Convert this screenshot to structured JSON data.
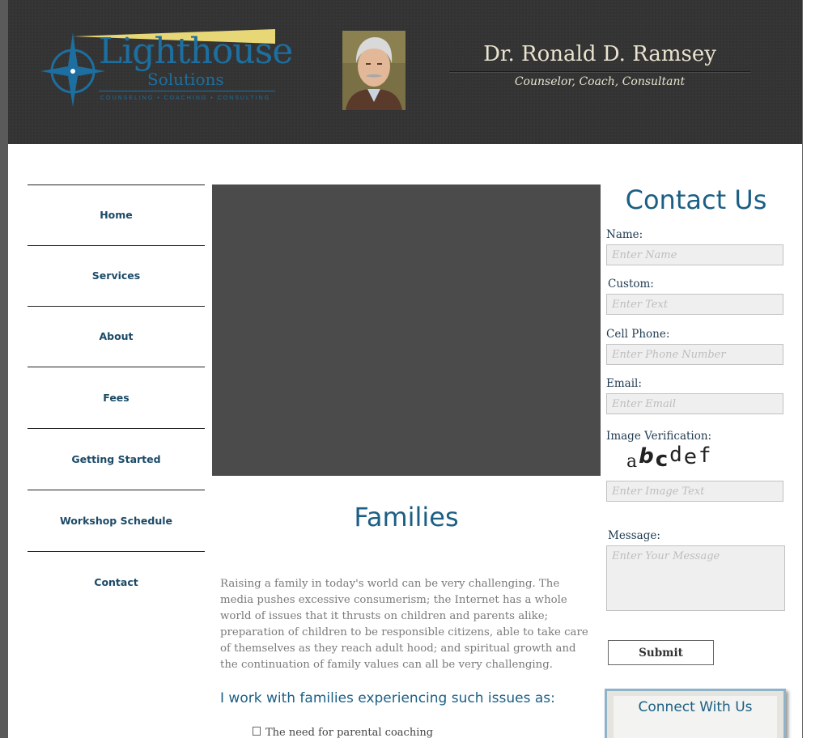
{
  "header": {
    "logo": {
      "title": "Lighthouse",
      "subtitle": "Solutions",
      "tagline": "COUNSELING • COACHING • CONSULTING"
    },
    "doctor_name": "Dr. Ronald D. Ramsey",
    "doctor_subtitle": "Counselor, Coach, Consultant"
  },
  "nav": {
    "items": [
      {
        "label": "Home"
      },
      {
        "label": "Services"
      },
      {
        "label": "About"
      },
      {
        "label": "Fees"
      },
      {
        "label": "Getting Started"
      },
      {
        "label": "Workshop Schedule"
      },
      {
        "label": "Contact"
      }
    ]
  },
  "main": {
    "title": "Families",
    "paragraph": "Raising a family in today's world can be very challenging.  The media pushes excessive consumerism; the Internet has a whole world of issues that it thrusts on children and parents alike; preparation of children to be responsible citizens, able to take care of themselves as they reach adult hood; and spiritual growth and the continuation of family values can all be very challenging.",
    "issues_heading": "I work with families experiencing such issues as:",
    "first_issue": "The need for parental coaching"
  },
  "contact": {
    "title": "Contact Us",
    "name_label": "Name:",
    "name_placeholder": "Enter Name",
    "custom_label": "Custom:",
    "custom_placeholder": "Enter Text",
    "phone_label": "Cell Phone:",
    "phone_placeholder": "Enter Phone Number",
    "email_label": "Email:",
    "email_placeholder": "Enter Email",
    "verification_label": "Image Verification:",
    "captcha": [
      "a",
      "b",
      "c",
      "d",
      "e",
      "f"
    ],
    "verification_placeholder": "Enter Image Text",
    "message_label": "Message:",
    "message_placeholder": "Enter Your Message",
    "submit_label": "Submit"
  },
  "connect": {
    "title": "Connect With Us"
  },
  "colors": {
    "brand_blue": "#1b5f84",
    "header_bg": "#333333",
    "beam_yellow": "#e8d777"
  }
}
